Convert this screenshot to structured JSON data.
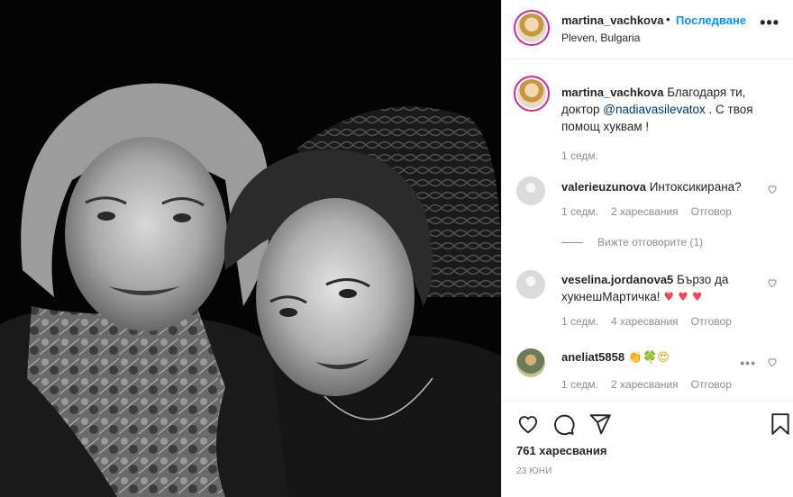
{
  "post": {
    "username": "martina_vachkova",
    "separator": "•",
    "follow_label": "Последване",
    "location": "Pleven, Bulgaria",
    "more_icon": "more-horizontal-icon"
  },
  "caption": {
    "username": "martina_vachkova",
    "text_before": " Благодаря ти, доктор ",
    "mention": "@nadiavasilevatox",
    "text_after": " . С твоя помощ хуквам !",
    "time": "1 седм."
  },
  "comments": [
    {
      "username": "valerieuzunova",
      "text": " Интоксикирана?",
      "time": "1 седм.",
      "likes": "2 харесвания",
      "reply_label": "Отговор",
      "view_replies": "Вижте отговорите (1)"
    },
    {
      "username": "veselina.jordanova5",
      "text": " Бързо да хукнешМартичка!",
      "emoji": "♥ ♥ ♥",
      "time": "1 седм.",
      "likes": "4 харесвания",
      "reply_label": "Отговор"
    },
    {
      "username": "aneliat5858",
      "emoji_1": "👏",
      "emoji_2": "🍀",
      "emoji_3": "😍",
      "time": "1 седм.",
      "likes": "2 харесвания",
      "reply_label": "Отговор",
      "more": "•••"
    }
  ],
  "actions": {
    "like_icon": "heart-outline-icon",
    "comment_icon": "comment-icon",
    "share_icon": "paper-plane-icon",
    "save_icon": "bookmark-icon",
    "likes_count": "761 харесвания",
    "date": "23 ЮНИ"
  },
  "colors": {
    "accent_blue": "#0095f6",
    "mention": "#00376b",
    "muted": "#8e8e8e",
    "border": "#efefef",
    "heart_red": "#ed4956"
  }
}
